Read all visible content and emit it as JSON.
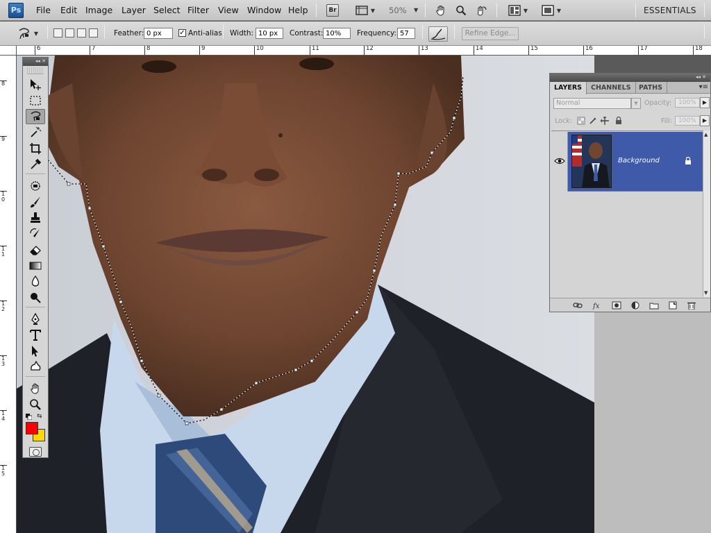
{
  "app": {
    "logo": "Ps"
  },
  "menu": [
    "File",
    "Edit",
    "Image",
    "Layer",
    "Select",
    "Filter",
    "View",
    "Window",
    "Help"
  ],
  "appbar": {
    "bridge": "Br",
    "zoom": "50%",
    "workspace": "ESSENTIALS"
  },
  "options": {
    "feather_label": "Feather:",
    "feather_value": "0 px",
    "antialias_label": "Anti-alias",
    "antialias_checked": true,
    "width_label": "Width:",
    "width_value": "10 px",
    "contrast_label": "Contrast:",
    "contrast_value": "10%",
    "frequency_label": "Frequency:",
    "frequency_value": "57",
    "refine_edge": "Refine Edge..."
  },
  "rulers": {
    "horizontal": [
      "6",
      "7",
      "8",
      "9",
      "10",
      "11",
      "12",
      "13",
      "14",
      "15",
      "16",
      "17",
      "18"
    ],
    "vertical": [
      "8",
      "9",
      "10",
      "11",
      "12",
      "13",
      "14",
      "15"
    ]
  },
  "tools": {
    "active": "magnetic-lasso",
    "foreground_color": "#ff0000",
    "background_color": "#ffd700"
  },
  "layers_panel": {
    "tabs": [
      "LAYERS",
      "CHANNELS",
      "PATHS"
    ],
    "blend_mode": "Normal",
    "opacity_label": "Opacity:",
    "opacity_value": "100%",
    "lock_label": "Lock:",
    "fill_label": "Fill:",
    "fill_value": "100%",
    "layers": [
      {
        "name": "Background",
        "visible": true,
        "locked": true
      }
    ]
  }
}
